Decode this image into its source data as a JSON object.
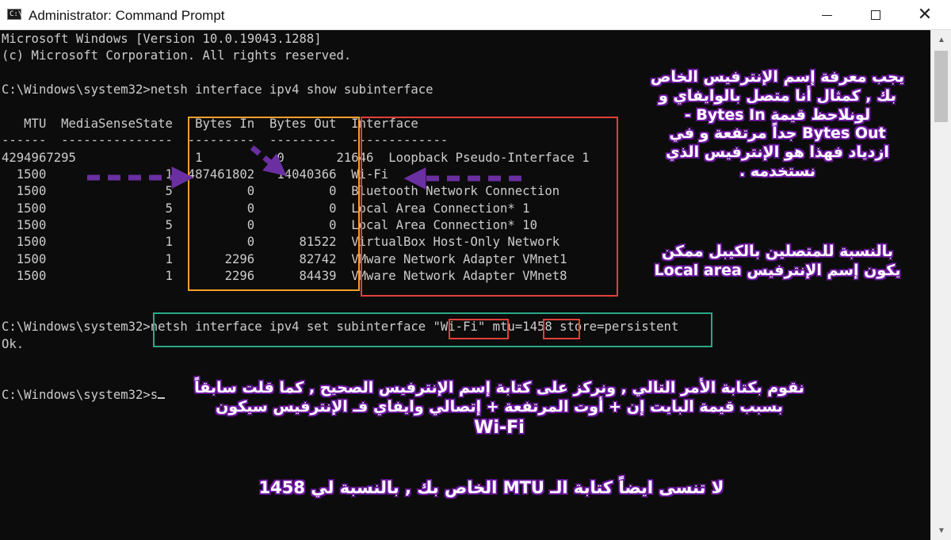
{
  "window": {
    "title": "Administrator: Command Prompt",
    "icon_label": "C:\\."
  },
  "console": {
    "lines": [
      "Microsoft Windows [Version 10.0.19043.1288]",
      "(c) Microsoft Corporation. All rights reserved.",
      "",
      "C:\\Windows\\system32>netsh interface ipv4 show subinterface",
      "",
      "   MTU  MediaSenseState   Bytes In  Bytes Out  Interface",
      "------  ---------------  ---------  ---------  -------------",
      "4294967295                1          0       21646  Loopback Pseudo-Interface 1",
      "  1500                1  487461802   14040366  Wi-Fi",
      "  1500                5          0          0  Bluetooth Network Connection",
      "  1500                5          0          0  Local Area Connection* 1",
      "  1500                5          0          0  Local Area Connection* 10",
      "  1500                1          0      81522  VirtualBox Host-Only Network",
      "  1500                1       2296      82742  VMware Network Adapter VMnet1",
      "  1500                1       2296      84439  VMware Network Adapter VMnet8",
      "",
      "C:\\Windows\\system32>netsh interface ipv4 set subinterface \"Wi-Fi\" mtu=1458 store=persistent",
      "Ok.",
      "",
      "",
      "C:\\Windows\\system32>s"
    ]
  },
  "annotations": {
    "note_top_right": [
      "يجب معرفة إسم الإنترفيس الخاص",
      "بك , كمثال أنا متصل بالوايفاي و",
      "لونلاحظ قيمة  Bytes In -",
      "Bytes Out جداً مرتفعة و في",
      "ازدياد فهذا هو الإنترفيس الذي",
      "نستخدمه ."
    ],
    "note_middle_right": [
      "بالنسبة للمتصلين بالكيبل ممكن",
      "يكون إسم الإنترفيس  Local area"
    ],
    "note_bottom": [
      "نقوم بكتابة الأمر التالي , ونركز على كتابة إسم الإنترفيس الصحيح , كما قلت سابقاً",
      "بسبب قيمة البايت إن + أوت المرتفعة + إتصالي وايفاي فـ الإنترفيس سيكون",
      "Wi-Fi"
    ],
    "note_mtu": "لا تنسى ايضاً كتابة الـ MTU الخاص بك , بالنسبة لي 1458"
  },
  "colors": {
    "console_bg": "#0c0c0c",
    "console_text": "#cccccc",
    "box_orange": "#f0a22a",
    "box_red": "#e0403c",
    "box_teal": "#2aa889",
    "arrow_purple": "#6a2fa0",
    "note_outline": "#7a1fb0"
  }
}
